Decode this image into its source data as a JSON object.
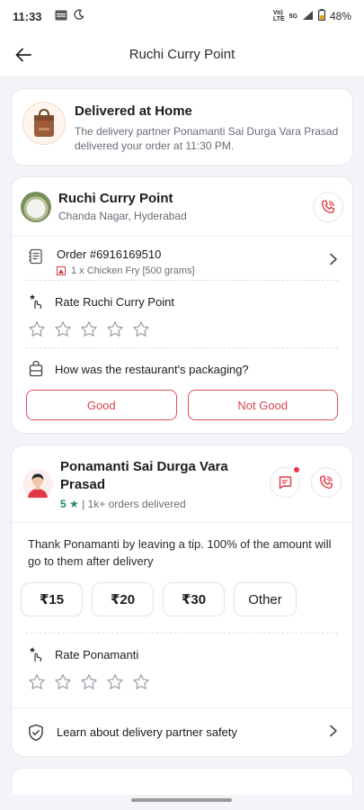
{
  "status_bar": {
    "time": "11:33",
    "network_volte": "Vo)\nLTE",
    "network_5g": "5G",
    "battery_percent": "48%"
  },
  "header": {
    "title": "Ruchi Curry Point",
    "back_icon": "arrow-left-icon"
  },
  "delivery_status": {
    "title": "Delivered at Home",
    "description": "The delivery partner Ponamanti Sai Durga Vara Prasad delivered your order at 11:30 PM.",
    "icon": "shopping-bag-icon"
  },
  "restaurant": {
    "name": "Ruchi Curry Point",
    "location": "Chanda Nagar, Hyderabad",
    "order_id": "Order #6916169510",
    "order_item": "1 x Chicken Fry [500 grams]",
    "rate_label": "Rate Ruchi Curry Point",
    "stars_total": 5,
    "stars_selected": 0,
    "packaging_question": "How was the restaurant's packaging?",
    "packaging_options": [
      "Good",
      "Not Good"
    ]
  },
  "delivery_partner": {
    "name": "Ponamanti Sai Durga Vara Prasad",
    "rating": "5 ★",
    "orders_delivered": "| 1k+ orders delivered",
    "tip_text": "Thank Ponamanti by leaving a tip. 100% of the amount will go to them after delivery",
    "tip_options": [
      "₹15",
      "₹20",
      "₹30",
      "Other"
    ],
    "rate_label": "Rate Ponamanti",
    "stars_total": 5,
    "stars_selected": 0,
    "safety_link": "Learn about delivery partner safety"
  },
  "colors": {
    "accent_red": "#e23744",
    "rating_green": "#2e8b57",
    "muted_text": "#6b6b78"
  }
}
